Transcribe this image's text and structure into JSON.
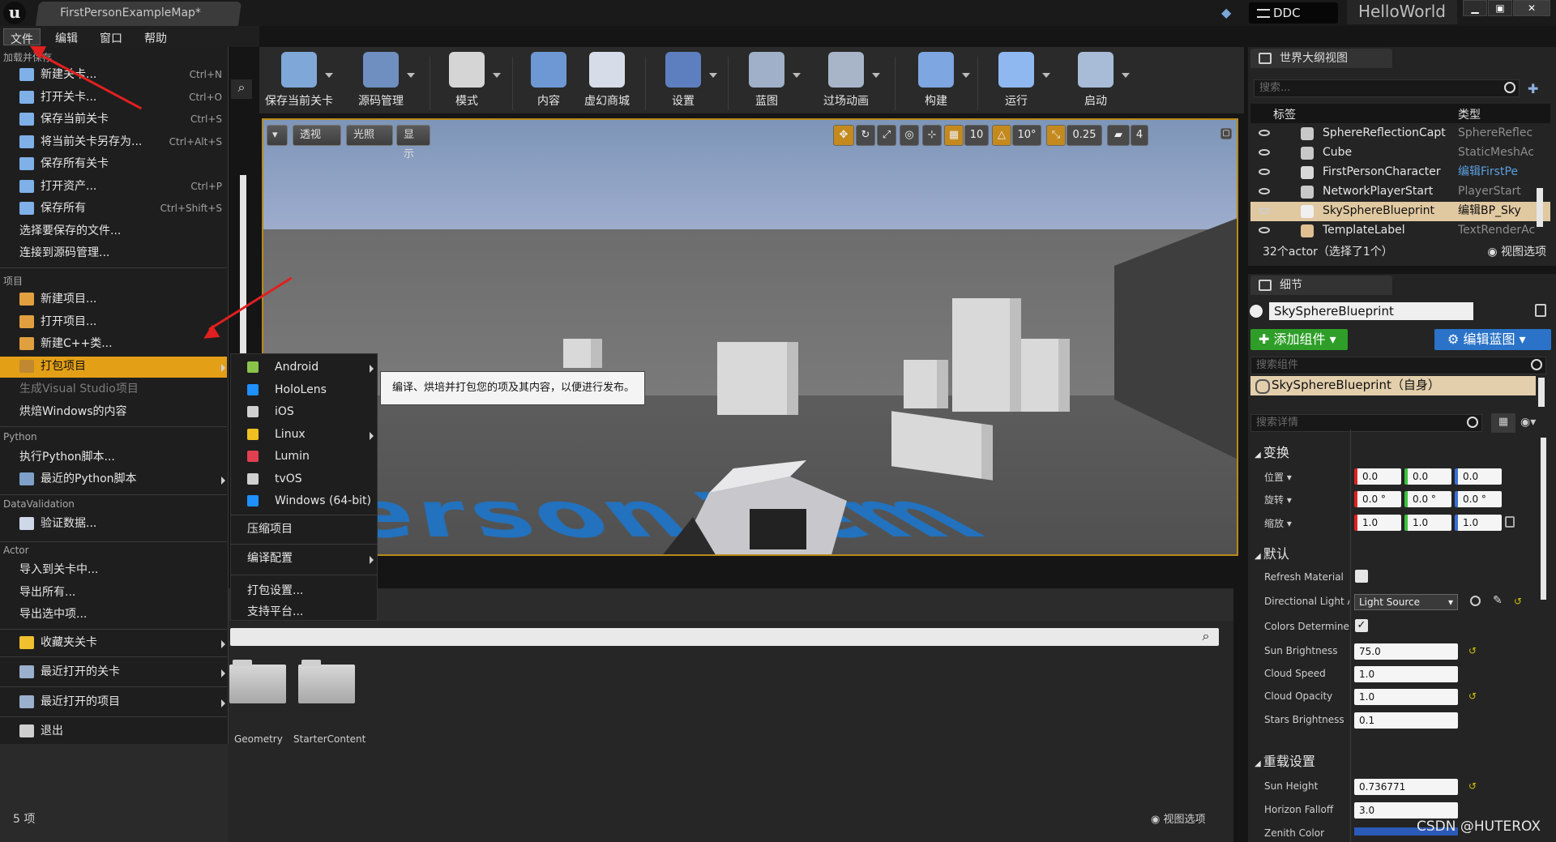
{
  "window": {
    "tab_title": "FirstPersonExampleMap*",
    "ddc_label": "DDC",
    "project_name": "HelloWorld",
    "min_glyph": "▁",
    "max_glyph": "▣",
    "close_glyph": "✕"
  },
  "menubar": {
    "file": "文件",
    "edit": "编辑",
    "window": "窗口",
    "help": "帮助"
  },
  "toolbar": [
    {
      "label": "保存当前关卡",
      "icon": "floppy-disk-icon",
      "color": "#7fa7d8"
    },
    {
      "label": "源码管理",
      "icon": "source-control-icon",
      "color": "#6e8fbf"
    },
    {
      "label": "模式",
      "icon": "modes-tools-icon",
      "color": "#d5d5d5"
    },
    {
      "label": "内容",
      "icon": "content-grid-icon",
      "color": "#6d98d4"
    },
    {
      "label": "虚幻商城",
      "icon": "marketplace-icon",
      "color": "#d6dce8"
    },
    {
      "label": "设置",
      "icon": "settings-gear-icon",
      "color": "#5e7fbf"
    },
    {
      "label": "蓝图",
      "icon": "blueprint-icon",
      "color": "#9fb0c8"
    },
    {
      "label": "过场动画",
      "icon": "clapperboard-icon",
      "color": "#a8b4c8"
    },
    {
      "label": "构建",
      "icon": "build-cubes-icon",
      "color": "#7ea6e0"
    },
    {
      "label": "运行",
      "icon": "play-icon",
      "color": "#8fb8f0"
    },
    {
      "label": "启动",
      "icon": "launch-icon",
      "color": "#a8bcd8"
    }
  ],
  "viewport": {
    "perspective": "透视",
    "lighting": "光照",
    "show": "显示",
    "grid_snap": "10",
    "rotation_snap": "10°",
    "scale_snap": "0.25",
    "camera_speed": "4",
    "floor_text": "Person Tem"
  },
  "file_menu": {
    "section_load": "加载并保存",
    "items_load": [
      {
        "label": "新建关卡...",
        "shortcut": "Ctrl+N",
        "color": "#7fb0e8"
      },
      {
        "label": "打开关卡...",
        "shortcut": "Ctrl+O",
        "color": "#7fb0e8"
      },
      {
        "label": "保存当前关卡",
        "shortcut": "Ctrl+S",
        "color": "#7fb0e8"
      },
      {
        "label": "将当前关卡另存为...",
        "shortcut": "Ctrl+Alt+S",
        "color": "#7fb0e8"
      },
      {
        "label": "保存所有关卡",
        "shortcut": "",
        "color": "#7fb0e8"
      },
      {
        "label": "打开资产...",
        "shortcut": "Ctrl+P",
        "color": "#7fb0e8"
      },
      {
        "label": "保存所有",
        "shortcut": "Ctrl+Shift+S",
        "color": "#7fb0e8"
      },
      {
        "label": "选择要保存的文件...",
        "shortcut": "",
        "color": ""
      },
      {
        "label": "连接到源码管理...",
        "shortcut": "",
        "color": ""
      }
    ],
    "section_project": "项目",
    "items_project": [
      {
        "label": "新建项目...",
        "color": "#e0a040"
      },
      {
        "label": "打开项目...",
        "color": "#e0a040"
      },
      {
        "label": "新建C++类...",
        "color": "#e0a040"
      },
      {
        "label": "打包项目",
        "color": "#c08830"
      },
      {
        "label": "生成Visual Studio项目",
        "color": ""
      },
      {
        "label": "烘焙Windows的内容",
        "color": ""
      }
    ],
    "section_python": "Python",
    "items_python": [
      {
        "label": "执行Python脚本...",
        "color": ""
      },
      {
        "label": "最近的Python脚本",
        "color": "#7fa0c8"
      }
    ],
    "section_validation": "DataValidation",
    "items_validation": [
      {
        "label": "验证数据...",
        "color": "#cfd8e8"
      }
    ],
    "section_actor": "Actor",
    "items_actor": [
      {
        "label": "导入到关卡中...",
        "color": ""
      },
      {
        "label": "导出所有...",
        "color": ""
      },
      {
        "label": "导出选中项...",
        "color": ""
      }
    ],
    "favorites": "收藏夹关卡",
    "recent_levels": "最近打开的关卡",
    "recent_projects": "最近打开的项目",
    "exit": "退出"
  },
  "package_submenu": {
    "platforms": [
      {
        "label": "Android",
        "icon": "android-icon",
        "color": "#8bc34a",
        "has_arrow": true
      },
      {
        "label": "HoloLens",
        "icon": "windows-icon",
        "color": "#1e90ff",
        "has_arrow": false
      },
      {
        "label": "iOS",
        "icon": "apple-icon",
        "color": "#d0d0d0",
        "has_arrow": false
      },
      {
        "label": "Linux",
        "icon": "linux-icon",
        "color": "#f0c020",
        "has_arrow": true
      },
      {
        "label": "Lumin",
        "icon": "lumin-icon",
        "color": "#e04050",
        "has_arrow": false
      },
      {
        "label": "tvOS",
        "icon": "apple-icon",
        "color": "#d0d0d0",
        "has_arrow": false
      },
      {
        "label": "Windows (64-bit)",
        "icon": "windows-icon",
        "color": "#1e90ff",
        "has_arrow": false
      }
    ],
    "zip_project": "压缩项目",
    "build_config": "编译配置",
    "packaging_settings": "打包设置...",
    "supported_platforms": "支持平台...",
    "tooltip": "编译、烘培并打包您的项及其内容，以便进行发布。"
  },
  "content_browser": {
    "folders": [
      "Geometry",
      "StarterContent"
    ],
    "item_count": "5 项",
    "view_options": "视图选项"
  },
  "outliner": {
    "tab": "世界大纲视图",
    "search_placeholder": "搜索...",
    "col_label": "标签",
    "col_type": "类型",
    "rows": [
      {
        "name": "SphereReflectionCapt",
        "type": "SphereReflec",
        "link": false,
        "selected": false,
        "color": "#c8c8c8"
      },
      {
        "name": "Cube",
        "type": "StaticMeshAc",
        "link": false,
        "selected": false,
        "color": "#c8c8c8"
      },
      {
        "name": "FirstPersonCharacter",
        "type": "编辑FirstPe",
        "link": true,
        "selected": false,
        "color": "#d8d8d8"
      },
      {
        "name": "NetworkPlayerStart",
        "type": "PlayerStart",
        "link": false,
        "selected": false,
        "color": "#c8c8c8"
      },
      {
        "name": "SkySphereBlueprint",
        "type": "编辑BP_Sky",
        "link": true,
        "selected": true,
        "color": "#f0f0f0"
      },
      {
        "name": "TemplateLabel",
        "type": "TextRenderAc",
        "link": false,
        "selected": false,
        "color": "#e0c090"
      }
    ],
    "summary": "32个actor（选择了1个）",
    "view_options": "视图选项"
  },
  "details": {
    "tab": "细节",
    "object_name": "SkySphereBlueprint",
    "add_component": "添加组件",
    "edit_blueprint": "编辑蓝图",
    "search_components": "搜索组件",
    "self_component": "SkySphereBlueprint（自身）",
    "search_details": "搜索详情",
    "cat_transform": "变换",
    "location": "位置",
    "rotation": "旋转",
    "scale": "缩放",
    "loc_vals": [
      "0.0",
      "0.0",
      "0.0"
    ],
    "rot_vals": [
      "0.0 °",
      "0.0 °",
      "0.0 °"
    ],
    "scale_vals": [
      "1.0",
      "1.0",
      "1.0"
    ],
    "cat_default": "默认",
    "props": [
      {
        "label": "Refresh Material",
        "kind": "check",
        "value": ""
      },
      {
        "label": "Directional Light A",
        "kind": "select",
        "value": "Light Source"
      },
      {
        "label": "Colors Determinec",
        "kind": "check",
        "value": "✓"
      },
      {
        "label": "Sun Brightness",
        "kind": "num",
        "value": "75.0"
      },
      {
        "label": "Cloud Speed",
        "kind": "num",
        "value": "1.0"
      },
      {
        "label": "Cloud Opacity",
        "kind": "num",
        "value": "1.0"
      },
      {
        "label": "Stars Brightness",
        "kind": "num",
        "value": "0.1"
      }
    ],
    "cat_override": "重载设置",
    "override_props": [
      {
        "label": "Sun Height",
        "value": "0.736771"
      },
      {
        "label": "Horizon Falloff",
        "value": "3.0"
      },
      {
        "label": "Zenith Color",
        "value": ""
      }
    ]
  },
  "watermark": "CSDN @HUTEROX"
}
